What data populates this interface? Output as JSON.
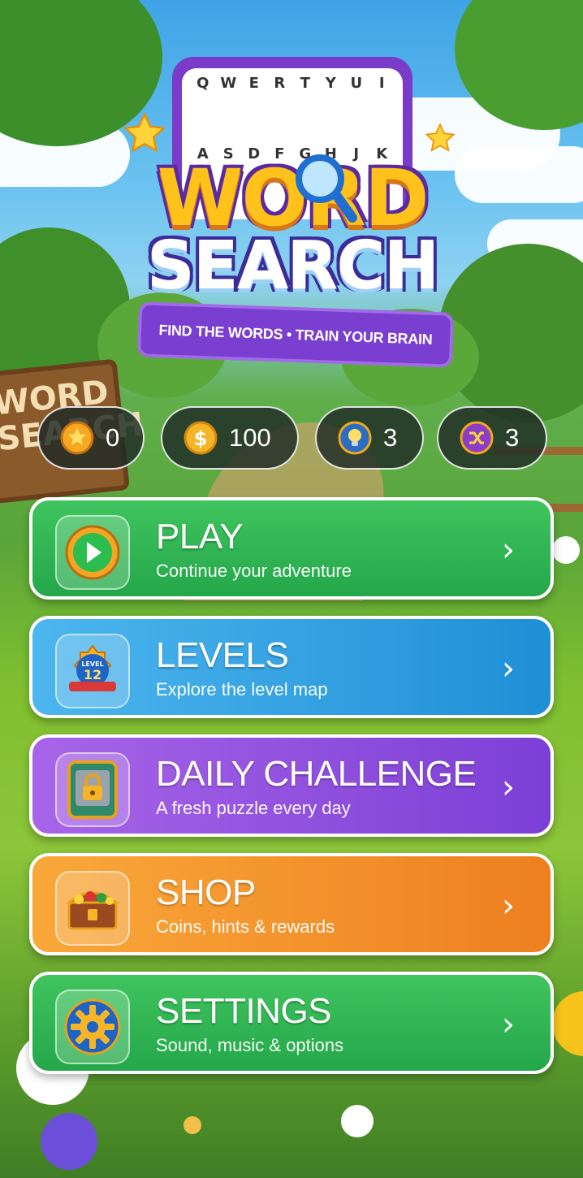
{
  "logo": {
    "grid_letters": [
      "Q",
      "W",
      "E",
      "R",
      "T",
      "Y",
      "U",
      "I",
      "A",
      "S",
      "D",
      "F",
      "G",
      "H",
      "J",
      "K"
    ],
    "word1": "WORD",
    "word2": "SEARCH",
    "tagline": "FIND THE WORDS • TRAIN YOUR BRAIN"
  },
  "background": {
    "sign_text": "WORD SEARCH"
  },
  "stats": [
    {
      "icon": "star-coin-icon",
      "value": "0"
    },
    {
      "icon": "gold-coin-icon",
      "value": "100"
    },
    {
      "icon": "hint-bulb-icon",
      "value": "3"
    },
    {
      "icon": "shuffle-icon",
      "value": "3"
    }
  ],
  "menu": {
    "play": {
      "title": "PLAY",
      "subtitle": "Continue your adventure",
      "chevron": "›",
      "icon": "play-icon"
    },
    "levels": {
      "title": "LEVELS",
      "subtitle": "Explore the level map",
      "chevron": "›",
      "icon": "level-badge-icon",
      "badge_top": "LEVEL",
      "badge_num": "12"
    },
    "daily": {
      "title": "DAILY CHALLENGE",
      "subtitle": "A fresh puzzle every day",
      "chevron": "›",
      "icon": "lock-icon"
    },
    "shop": {
      "title": "SHOP",
      "subtitle": "Coins, hints & rewards",
      "chevron": "›",
      "icon": "treasure-chest-icon"
    },
    "settings": {
      "title": "SETTINGS",
      "subtitle": "Sound, music & options",
      "chevron": "›",
      "icon": "gear-icon"
    }
  },
  "colors": {
    "play": "#2fb553",
    "levels": "#2a9fe0",
    "daily": "#8c4ee0",
    "shop": "#f39227",
    "settings": "#2fb553"
  }
}
